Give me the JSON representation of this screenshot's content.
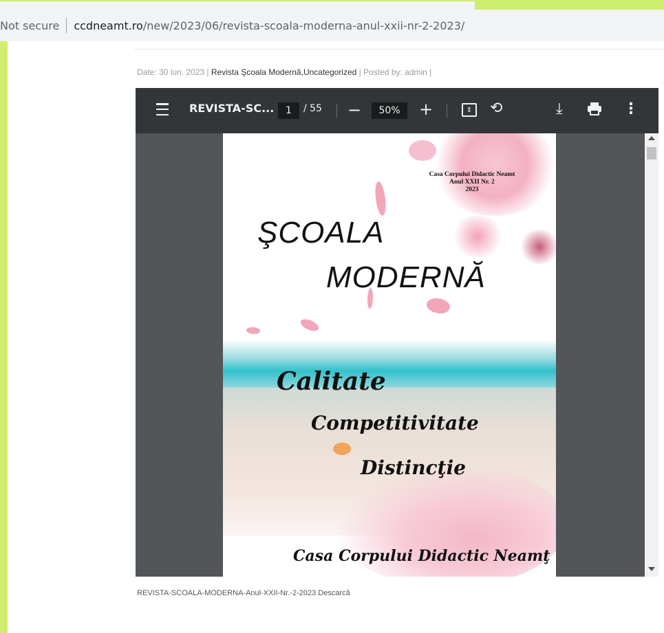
{
  "browser": {
    "not_secure": "Not secure",
    "url_host": "ccdneamt.ro",
    "url_path": "/new/2023/06/revista-scoala-moderna-anul-xxii-nr-2-2023/"
  },
  "post_meta": {
    "date_prefix": "Date: 30 iun. 2023 |",
    "categories": "Revista Şcoala Modernă,Uncategorized",
    "posted_by": "| Posted by: admin |"
  },
  "pdf_viewer": {
    "doc_title": "REVISTA-SC...",
    "current_page": "1",
    "total_pages": "/ 55",
    "zoom": "50%",
    "icons": [
      "menu-icon",
      "minus-icon",
      "plus-icon",
      "fit-page-icon",
      "rotate-icon",
      "download-icon",
      "print-icon",
      "more-icon"
    ]
  },
  "cover": {
    "publisher_line1": "Casa Corpului Didactic Neamt",
    "publisher_line2": "Anul XXII Nr. 2",
    "publisher_line3": "2023",
    "title_line1": "ŞCOALA",
    "title_line2": "MODERNĂ",
    "motto1": "Calitate",
    "motto2": "Competitivitate",
    "motto3": "Distincţie",
    "footer": "Casa Corpului Didactic Neamţ"
  },
  "footer": {
    "file_name": "REVISTA-SCOALA-MODERNA-Anul-XXII-Nr.-2-2023",
    "download_label": "Descarcă"
  },
  "colors": {
    "accent_lime": "#cfee6f",
    "toolbar": "#323639",
    "viewer_bg": "#525659"
  }
}
